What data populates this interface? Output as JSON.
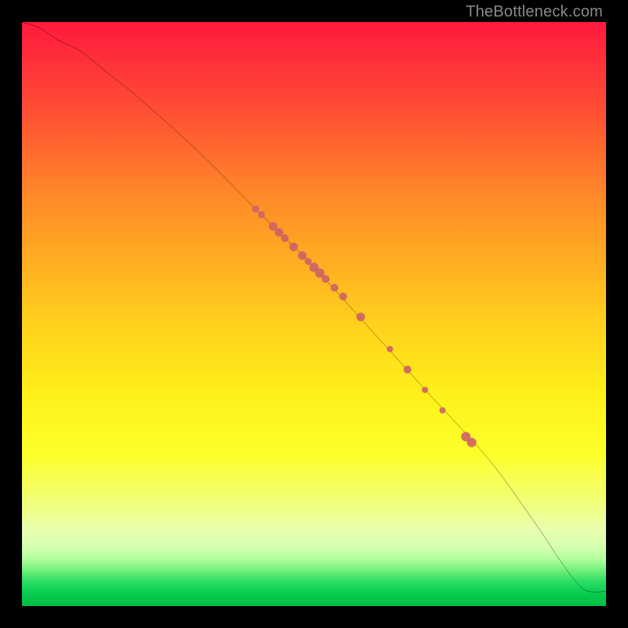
{
  "watermark": "TheBottleneck.com",
  "chart_data": {
    "type": "line",
    "title": "",
    "xlabel": "",
    "ylabel": "",
    "xlim": [
      0,
      100
    ],
    "ylim": [
      0,
      100
    ],
    "curve": {
      "name": "bottleneck-curve",
      "x": [
        0,
        3,
        6,
        10,
        15,
        20,
        30,
        40,
        50,
        60,
        70,
        80,
        88,
        92,
        95,
        97,
        100
      ],
      "y": [
        100,
        99,
        97,
        95,
        91,
        87,
        78,
        68,
        58,
        47,
        36,
        25,
        14,
        8,
        4,
        2.5,
        2.5
      ]
    },
    "points": {
      "name": "markers",
      "color": "#cf6464",
      "xy": [
        [
          40,
          68,
          9
        ],
        [
          41,
          67,
          9
        ],
        [
          43,
          65,
          11
        ],
        [
          44,
          64,
          11
        ],
        [
          45,
          63,
          10
        ],
        [
          46.5,
          61.5,
          11
        ],
        [
          48,
          60,
          11
        ],
        [
          49,
          59,
          9
        ],
        [
          50,
          58,
          12
        ],
        [
          51,
          57,
          12
        ],
        [
          52,
          56,
          10
        ],
        [
          53.5,
          54.5,
          10
        ],
        [
          55,
          53,
          10
        ],
        [
          58,
          49.5,
          11
        ],
        [
          63,
          44,
          8
        ],
        [
          66,
          40.5,
          10
        ],
        [
          69,
          37,
          8
        ],
        [
          72,
          33.5,
          8
        ],
        [
          76,
          29,
          12
        ],
        [
          77,
          28,
          12
        ]
      ]
    },
    "gradient_stops": [
      {
        "pos": 0,
        "color": "#ff1a3c"
      },
      {
        "pos": 50,
        "color": "#ffd21d"
      },
      {
        "pos": 85,
        "color": "#f3ff77"
      },
      {
        "pos": 100,
        "color": "#00c044"
      }
    ]
  }
}
